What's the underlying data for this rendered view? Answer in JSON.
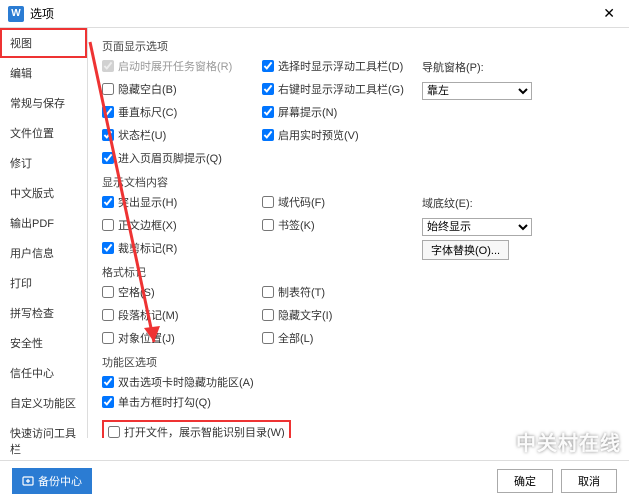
{
  "titlebar": {
    "title": "选项",
    "icon": "W"
  },
  "sidebar": {
    "items": [
      {
        "label": "视图",
        "active": true
      },
      {
        "label": "编辑"
      },
      {
        "label": "常规与保存"
      },
      {
        "label": "文件位置"
      },
      {
        "label": "修订"
      },
      {
        "label": "中文版式"
      },
      {
        "label": "输出PDF"
      },
      {
        "label": "用户信息"
      },
      {
        "label": "打印"
      },
      {
        "label": "拼写检查"
      },
      {
        "label": "安全性"
      },
      {
        "label": "信任中心"
      },
      {
        "label": "自定义功能区"
      },
      {
        "label": "快速访问工具栏"
      }
    ]
  },
  "sections": {
    "page_display": {
      "title": "页面显示选项",
      "items": {
        "startup_task": {
          "label": "启动时展开任务窗格(R)",
          "checked": false,
          "disabled": true
        },
        "float_select": {
          "label": "选择时显示浮动工具栏(D)",
          "checked": true
        },
        "nav_pane": {
          "label": "导航窗格(P):"
        },
        "hide_blank": {
          "label": "隐藏空白(B)",
          "checked": false
        },
        "rclick_float": {
          "label": "右键时显示浮动工具栏(G)",
          "checked": true
        },
        "align_left": "靠左",
        "vruler": {
          "label": "垂直标尺(C)",
          "checked": true
        },
        "screentip": {
          "label": "屏幕提示(N)",
          "checked": true
        },
        "statusbar": {
          "label": "状态栏(U)",
          "checked": true
        },
        "rt_preview": {
          "label": "启用实时预览(V)",
          "checked": true
        },
        "header_footer": {
          "label": "进入页眉页脚提示(Q)",
          "checked": true
        }
      }
    },
    "doc_content": {
      "title": "显示文档内容",
      "items": {
        "highlight": {
          "label": "突出显示(H)",
          "checked": true
        },
        "field_code": {
          "label": "域代码(F)",
          "checked": false
        },
        "field_shading": "域底纹(E):",
        "text_border": {
          "label": "正文边框(X)",
          "checked": false
        },
        "bookmark": {
          "label": "书签(K)",
          "checked": false
        },
        "always_show": "始终显示",
        "crop_mark": {
          "label": "裁剪标记(R)",
          "checked": true
        },
        "font_sub": "字体替换(O)..."
      }
    },
    "format_marks": {
      "title": "格式标记",
      "items": {
        "space": {
          "label": "空格(S)",
          "checked": false
        },
        "tab": {
          "label": "制表符(T)",
          "checked": false
        },
        "para_mark": {
          "label": "段落标记(M)",
          "checked": false
        },
        "hidden_text": {
          "label": "隐藏文字(I)",
          "checked": false
        },
        "obj_pos": {
          "label": "对象位置(J)",
          "checked": false
        },
        "all": {
          "label": "全部(L)",
          "checked": false
        }
      }
    },
    "ribbon": {
      "title": "功能区选项",
      "items": {
        "dblclick_hide": {
          "label": "双击选项卡时隐藏功能区(A)",
          "checked": true
        },
        "single_click": {
          "label": "单击方框时打勾(Q)",
          "checked": true
        },
        "open_smart": {
          "label": "打开文件，展示智能识别目录(W)",
          "checked": false
        }
      }
    }
  },
  "footer": {
    "backup": "备份中心",
    "ok": "确定",
    "cancel": "取消"
  },
  "watermark": "中关村在线"
}
